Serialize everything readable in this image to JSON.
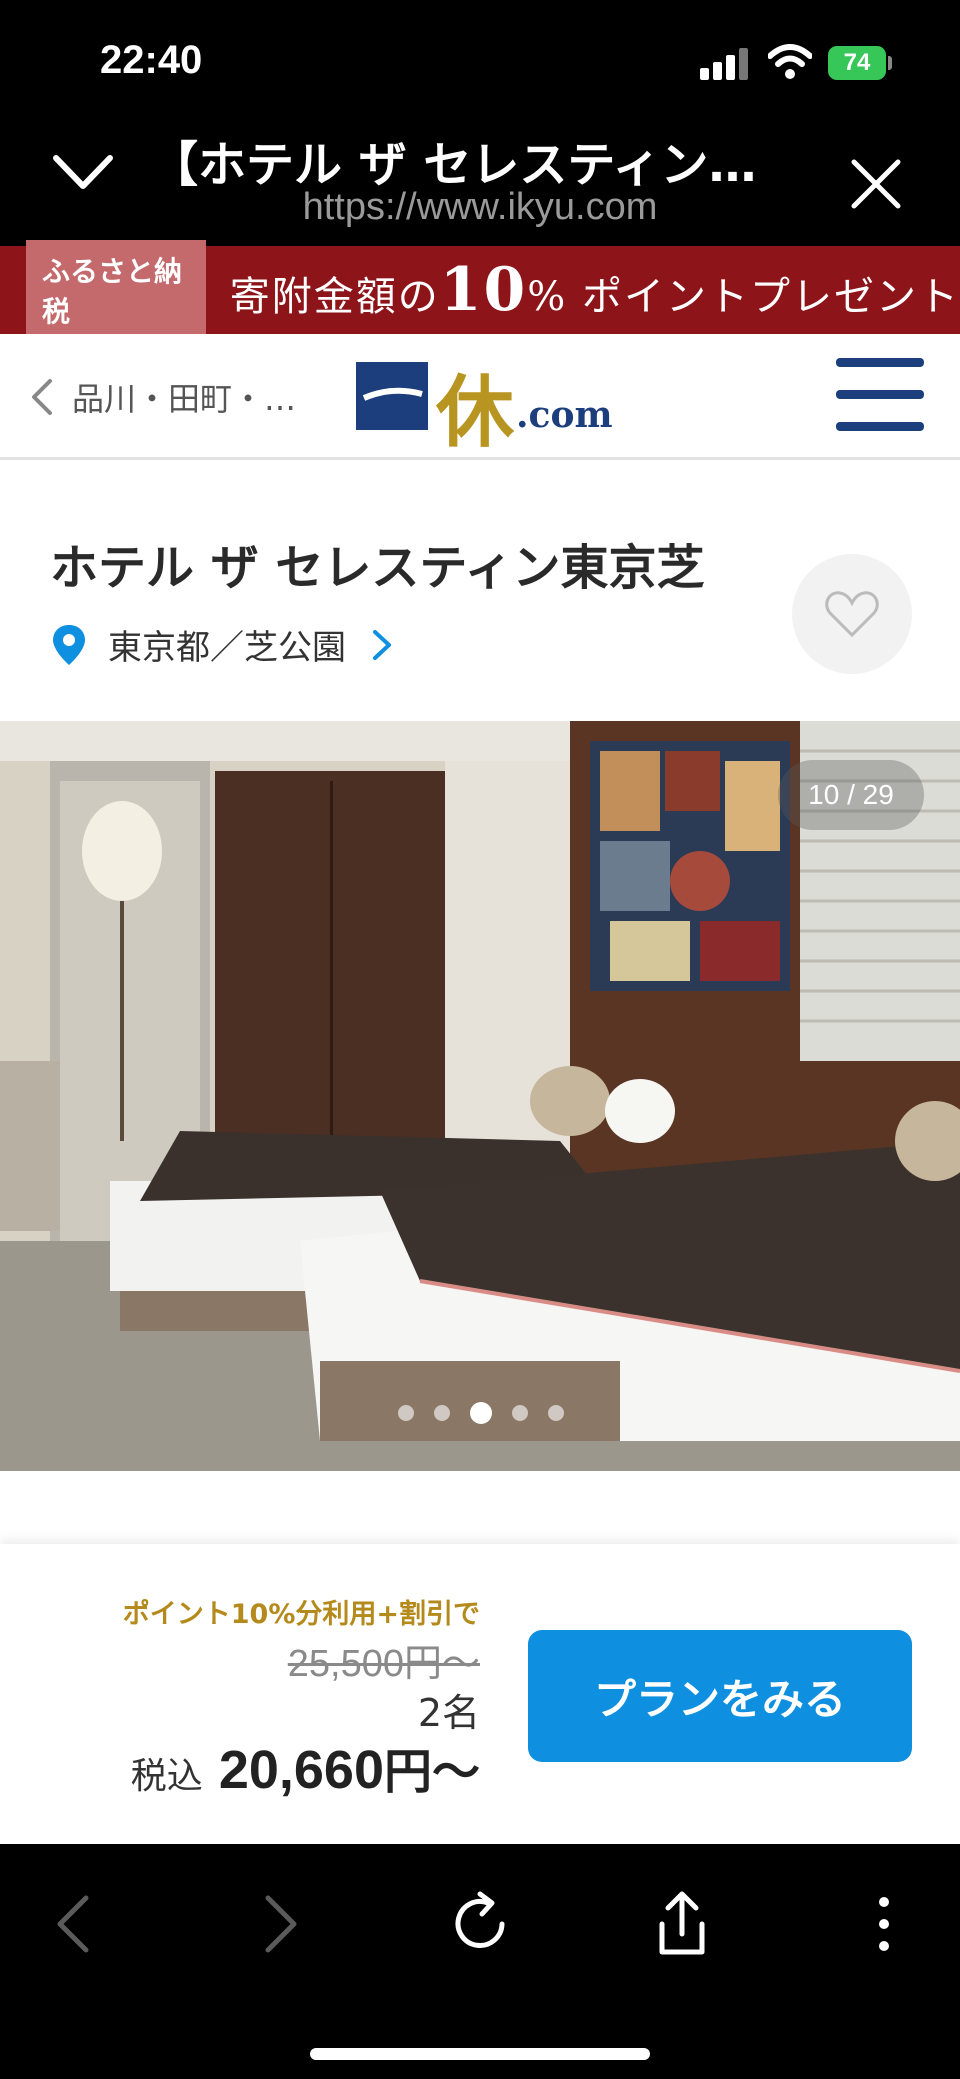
{
  "status_bar": {
    "time": "22:40",
    "battery": "74",
    "icons": [
      "signal-icon",
      "wifi-icon",
      "battery-icon"
    ]
  },
  "browser": {
    "page_title": "【ホテル ザ セレスティン…",
    "url": "https://www.ikyu.com"
  },
  "promo": {
    "tag": "ふるさと納税",
    "text_prefix": "寄附金額の",
    "text_big": "10",
    "text_suffix": "% ポイントプレゼント",
    "color": "#8d1419"
  },
  "header": {
    "back_label": "品川・田町・…",
    "logo_text": "一休",
    "logo_suffix": ".com"
  },
  "hotel": {
    "name": "ホテル ザ セレスティン東京芝",
    "location": "東京都／芝公園"
  },
  "gallery": {
    "counter": "10 / 29",
    "dot_count": 5,
    "active_dot": 3
  },
  "booking": {
    "point_note": "ポイント10%分利用+割引で",
    "original_price": "25,500円〜",
    "guests": "2名",
    "tax_label": "税込",
    "price": "20,660",
    "price_suffix": "円〜",
    "button_label": "プランをみる",
    "button_color": "#0e8fdf"
  }
}
